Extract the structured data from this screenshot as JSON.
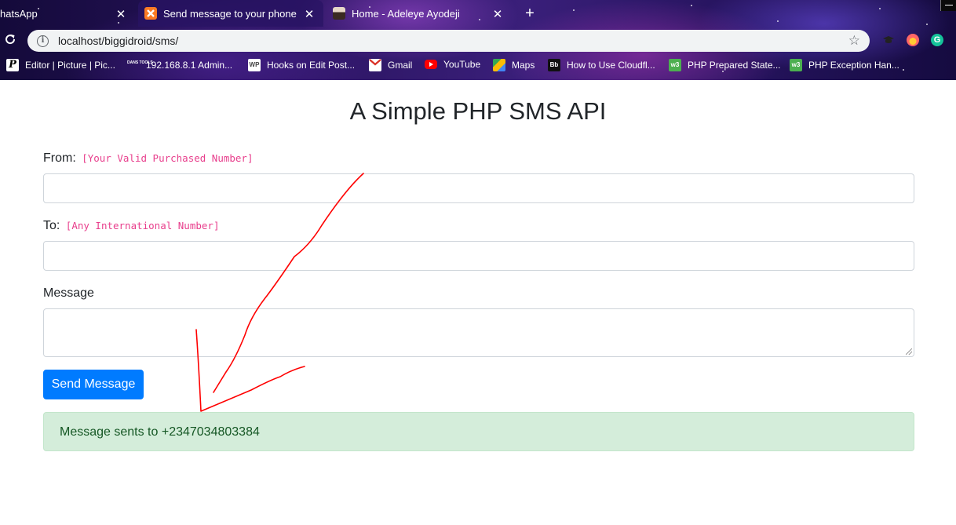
{
  "browser": {
    "tabs": [
      {
        "label": "hatsApp",
        "favicon": "whatsapp-icon",
        "active": false
      },
      {
        "label": "Send message to your phone",
        "favicon": "xampp-icon",
        "active": true
      },
      {
        "label": "Home - Adeleye Ayodeji",
        "favicon": "profile-photo-icon",
        "active": false
      }
    ],
    "url": "localhost/biggidroid/sms/",
    "bookmarks": [
      {
        "label": "Editor | Picture | Pic...",
        "icon": "picsart-icon"
      },
      {
        "label": "192.168.8.1 Admin...",
        "icon": "dans-tools-icon"
      },
      {
        "label": "Hooks on Edit Post...",
        "icon": "wordpress-icon"
      },
      {
        "label": "Gmail",
        "icon": "gmail-icon"
      },
      {
        "label": "YouTube",
        "icon": "youtube-icon"
      },
      {
        "label": "Maps",
        "icon": "maps-icon"
      },
      {
        "label": "How to Use Cloudfl...",
        "icon": "bb-icon"
      },
      {
        "label": "PHP Prepared State...",
        "icon": "w3schools-icon"
      },
      {
        "label": "PHP Exception Han...",
        "icon": "w3schools-icon"
      }
    ],
    "bookmark_icon_texts": {
      "dans": "DANS TOOLS",
      "wp": "WP",
      "bb": "Bb",
      "w3": "w3"
    }
  },
  "page": {
    "title": "A Simple PHP SMS API",
    "from_label": "From:",
    "from_hint": "[Your Valid Purchased Number]",
    "from_value": "",
    "to_label": "To:",
    "to_hint": "[Any International Number]",
    "to_value": "",
    "message_label": "Message",
    "message_value": "",
    "send_button": "Send Message",
    "success_message": "Message sents to +2347034803384"
  },
  "colors": {
    "primary": "#007bff",
    "alert_bg": "#d4edda",
    "alert_text": "#155724",
    "code_pink": "#e83e8c",
    "annotation_red": "#ff0000"
  }
}
